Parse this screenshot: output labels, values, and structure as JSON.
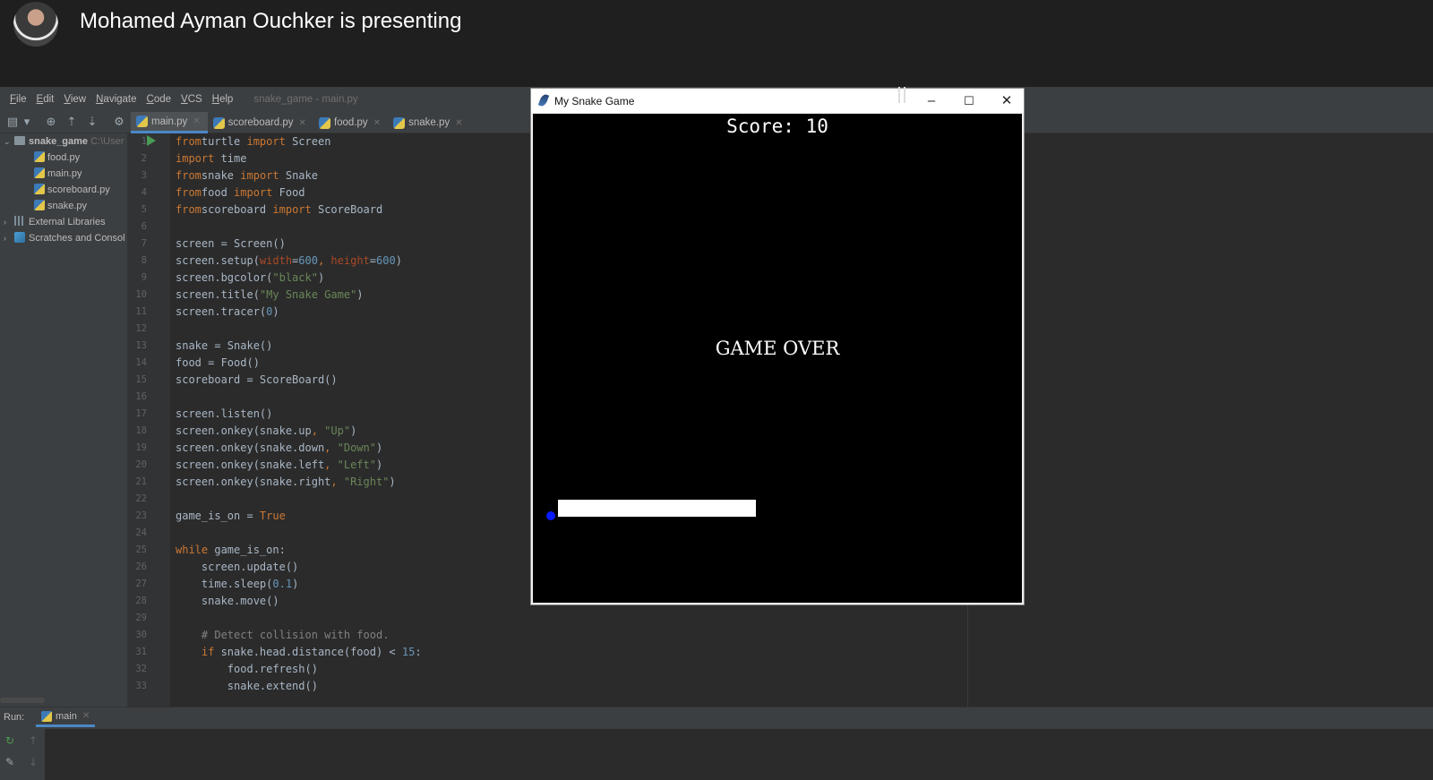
{
  "presenter": {
    "text": "Mohamed Ayman Ouchker is presenting"
  },
  "menu": {
    "items": [
      {
        "label": "File",
        "mnemonic": "F",
        "rest": "ile"
      },
      {
        "label": "Edit",
        "mnemonic": "E",
        "rest": "dit"
      },
      {
        "label": "View",
        "mnemonic": "V",
        "rest": "iew"
      },
      {
        "label": "Navigate",
        "mnemonic": "N",
        "rest": "avigate"
      },
      {
        "label": "Code",
        "mnemonic": "C",
        "rest": "ode"
      },
      {
        "label": "VCS",
        "mnemonic": "V",
        "rest": "CS"
      },
      {
        "label": "Help",
        "mnemonic": "H",
        "rest": "elp"
      }
    ],
    "project_title": "snake_game - main.py"
  },
  "tabs": [
    {
      "label": "main.py",
      "active": true
    },
    {
      "label": "scoreboard.py",
      "active": false
    },
    {
      "label": "food.py",
      "active": false
    },
    {
      "label": "snake.py",
      "active": false
    }
  ],
  "project": {
    "root": {
      "name": "snake_game",
      "path": "C:\\User"
    },
    "files": [
      "food.py",
      "main.py",
      "scoreboard.py",
      "snake.py"
    ],
    "external": "External Libraries",
    "scratches": "Scratches and Consol"
  },
  "code": {
    "line_numbers": [
      "1",
      "2",
      "3",
      "4",
      "5",
      "6",
      "7",
      "8",
      "9",
      "10",
      "11",
      "12",
      "13",
      "14",
      "15",
      "16",
      "17",
      "18",
      "19",
      "20",
      "21",
      "22",
      "23",
      "24",
      "25",
      "26",
      "27",
      "28",
      "29",
      "30",
      "31",
      "32",
      "33"
    ],
    "lines": [
      [
        [
          "kw",
          "from"
        ],
        [
          "",
          "turtle "
        ],
        [
          "kw",
          "import"
        ],
        [
          "",
          " Screen"
        ]
      ],
      [
        [
          "kw",
          "import"
        ],
        [
          "",
          " time"
        ]
      ],
      [
        [
          "kw",
          "from"
        ],
        [
          "",
          "snake "
        ],
        [
          "kw",
          "import"
        ],
        [
          "",
          " Snake"
        ]
      ],
      [
        [
          "kw",
          "from"
        ],
        [
          "",
          "food "
        ],
        [
          "kw",
          "import"
        ],
        [
          "",
          " Food"
        ]
      ],
      [
        [
          "kw",
          "from"
        ],
        [
          "",
          "scoreboard "
        ],
        [
          "kw",
          "import"
        ],
        [
          "",
          " ScoreBoard"
        ]
      ],
      [],
      [
        [
          "",
          "screen = Screen()"
        ]
      ],
      [
        [
          "",
          "screen.setup("
        ],
        [
          "param",
          "width"
        ],
        [
          "",
          "="
        ],
        [
          "num",
          "600"
        ],
        [
          "kw",
          ", "
        ],
        [
          "param",
          "height"
        ],
        [
          "",
          "="
        ],
        [
          "num",
          "600"
        ],
        [
          "",
          ")"
        ]
      ],
      [
        [
          "",
          "screen.bgcolor("
        ],
        [
          "str",
          "\"black\""
        ],
        [
          "",
          ")"
        ]
      ],
      [
        [
          "",
          "screen.title("
        ],
        [
          "str",
          "\"My Snake Game\""
        ],
        [
          "",
          ")"
        ]
      ],
      [
        [
          "",
          "screen.tracer("
        ],
        [
          "num",
          "0"
        ],
        [
          "",
          ")"
        ]
      ],
      [],
      [
        [
          "",
          "snake = Snake()"
        ]
      ],
      [
        [
          "",
          "food = Food()"
        ]
      ],
      [
        [
          "",
          "scoreboard = ScoreBoard()"
        ]
      ],
      [],
      [
        [
          "",
          "screen.listen()"
        ]
      ],
      [
        [
          "",
          "screen.onkey(snake.up"
        ],
        [
          "kw",
          ", "
        ],
        [
          "str",
          "\"Up\""
        ],
        [
          "",
          ")"
        ]
      ],
      [
        [
          "",
          "screen.onkey(snake.down"
        ],
        [
          "kw",
          ", "
        ],
        [
          "str",
          "\"Down\""
        ],
        [
          "",
          ")"
        ]
      ],
      [
        [
          "",
          "screen.onkey(snake.left"
        ],
        [
          "kw",
          ", "
        ],
        [
          "str",
          "\"Left\""
        ],
        [
          "",
          ")"
        ]
      ],
      [
        [
          "",
          "screen.onkey(snake.right"
        ],
        [
          "kw",
          ", "
        ],
        [
          "str",
          "\"Right\""
        ],
        [
          "",
          ")"
        ]
      ],
      [],
      [
        [
          "",
          "game_is_on = "
        ],
        [
          "kw",
          "True"
        ]
      ],
      [],
      [
        [
          "kw",
          "while"
        ],
        [
          "",
          " game_is_on:"
        ]
      ],
      [
        [
          "",
          "    screen.update()"
        ]
      ],
      [
        [
          "",
          "    time.sleep("
        ],
        [
          "num",
          "0.1"
        ],
        [
          "",
          ")"
        ]
      ],
      [
        [
          "",
          "    snake.move()"
        ]
      ],
      [],
      [
        [
          "cmt",
          "    # Detect collision with food."
        ]
      ],
      [
        [
          "kw",
          "    if"
        ],
        [
          "",
          " snake.head.distance(food) < "
        ],
        [
          "num",
          "15"
        ],
        [
          "",
          ":"
        ]
      ],
      [
        [
          "",
          "        food.refresh()"
        ]
      ],
      [
        [
          "",
          "        snake.extend()"
        ]
      ]
    ]
  },
  "run": {
    "label": "Run:",
    "tab": "main"
  },
  "game": {
    "window_title": "My Snake Game",
    "score_text": "Score: 10",
    "game_over_text": "GAME OVER",
    "window_controls": {
      "minimize": "–",
      "maximize": "☐",
      "close": "✕"
    }
  },
  "colors": {
    "keyword": "#cc7832",
    "string": "#6a8759",
    "number": "#6897bb",
    "param": "#aa4926",
    "comment": "#808080",
    "tab_accent": "#4a88c7"
  }
}
